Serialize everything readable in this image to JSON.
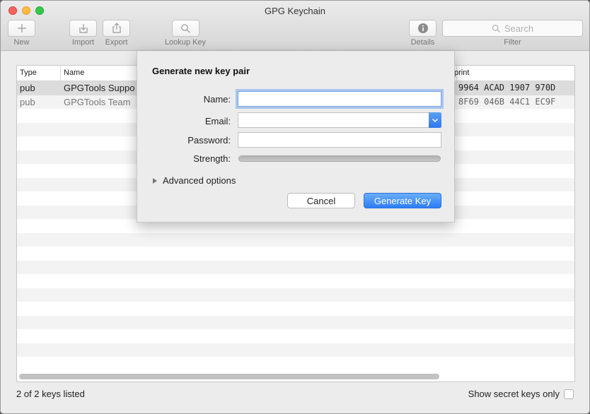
{
  "window": {
    "title": "GPG Keychain"
  },
  "toolbar": {
    "new": "New",
    "import": "Import",
    "export": "Export",
    "lookup": "Lookup Key",
    "details": "Details",
    "filter": "Filter",
    "search_placeholder": "Search"
  },
  "table": {
    "headers": {
      "type": "Type",
      "name": "Name",
      "fingerprint": "print"
    },
    "rows": [
      {
        "type": "pub",
        "name": "GPGTools Suppo",
        "fingerprint": "9964 ACAD 1907 970D"
      },
      {
        "type": "pub",
        "name": "GPGTools Team",
        "fingerprint": "8F69 046B 44C1 EC9F"
      }
    ]
  },
  "status": {
    "count": "2 of 2 keys listed",
    "secret_only": "Show secret keys only"
  },
  "sheet": {
    "title": "Generate new key pair",
    "name_label": "Name:",
    "name_value": "",
    "email_label": "Email:",
    "email_value": "",
    "password_label": "Password:",
    "password_value": "",
    "strength_label": "Strength:",
    "strength_value": 0,
    "advanced": "Advanced options",
    "cancel": "Cancel",
    "generate": "Generate Key"
  }
}
